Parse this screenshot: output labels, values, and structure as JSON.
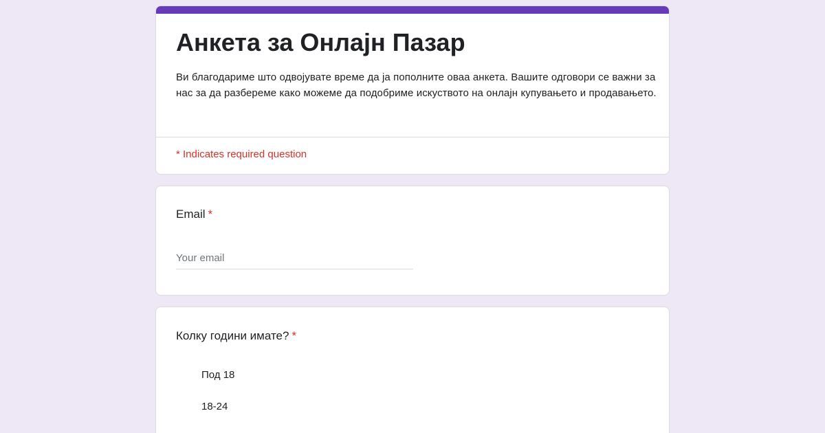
{
  "form": {
    "title": "Анкета за Онлајн Пазар",
    "description": "Ви благодариме што одвојувате време да ја пополните оваа анкета. Вашите одговори се важни за нас за да разбереме како можеме да подобриме искуството на онлајн купувањето и продавањето.",
    "required_note": "* Indicates required question"
  },
  "questions": {
    "email": {
      "title": "Email",
      "required_mark": "*",
      "placeholder": "Your email"
    },
    "age": {
      "title": "Колку години имате?",
      "required_mark": "*",
      "options": [
        "Под 18",
        "18-24"
      ]
    }
  },
  "colors": {
    "accent": "#673ab7",
    "background": "#ede7f6",
    "required": "#d93025"
  }
}
